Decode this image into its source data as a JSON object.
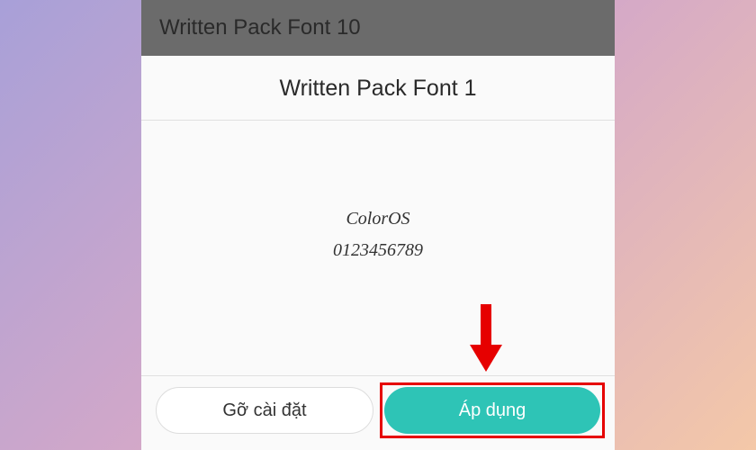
{
  "header": {
    "title": "Written Pack Font 10"
  },
  "page": {
    "title": "Written Pack Font 1"
  },
  "preview": {
    "brand": "ColorOS",
    "digits": "0123456789"
  },
  "buttons": {
    "uninstall": "Gỡ cài đặt",
    "apply": "Áp dụng"
  },
  "annotation": {
    "arrow_color": "#e60000",
    "highlight_color": "#e60000"
  }
}
